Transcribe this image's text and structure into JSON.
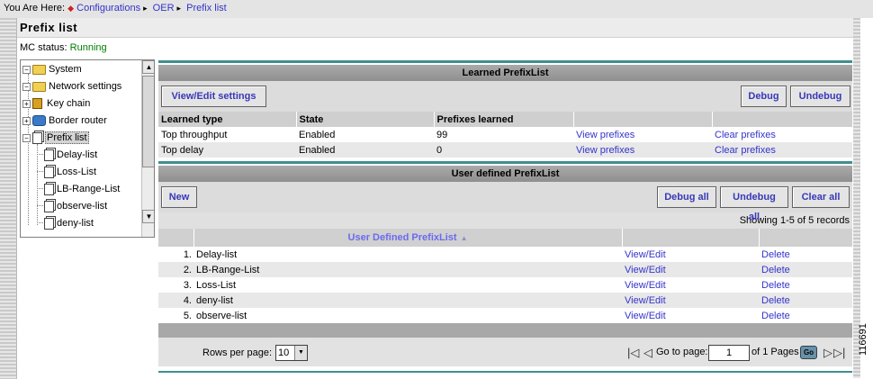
{
  "breadcrumb": {
    "prefix": "You Are Here:",
    "items": [
      "Configurations",
      "OER",
      "Prefix list"
    ]
  },
  "page_title": "Prefix list",
  "mc_status": {
    "label": "MC status:",
    "value": "Running"
  },
  "tree": {
    "items": [
      {
        "label": "System",
        "icon": "folder-icon",
        "expander": "minus"
      },
      {
        "label": "Network settings",
        "icon": "folder-icon",
        "expander": "minus"
      },
      {
        "label": "Key chain",
        "icon": "lock-icon",
        "expander": "plus"
      },
      {
        "label": "Border router",
        "icon": "router-icon",
        "expander": "plus"
      },
      {
        "label": "Prefix list",
        "icon": "document-icon",
        "expander": "minus",
        "selected": true
      },
      {
        "label": "Delay-list",
        "icon": "document-icon"
      },
      {
        "label": "Loss-List",
        "icon": "document-icon"
      },
      {
        "label": "LB-Range-List",
        "icon": "document-icon"
      },
      {
        "label": "observe-list",
        "icon": "document-icon"
      },
      {
        "label": "deny-list",
        "icon": "document-icon"
      }
    ]
  },
  "learned": {
    "title": "Learned PrefixList",
    "buttons": {
      "view_edit": "View/Edit settings",
      "debug": "Debug",
      "undebug": "Undebug"
    },
    "columns": [
      "Learned type",
      "State",
      "Prefixes learned",
      "",
      ""
    ],
    "rows": [
      {
        "type": "Top throughput",
        "state": "Enabled",
        "prefixes": "99",
        "view": "View prefixes",
        "clear": "Clear prefixes"
      },
      {
        "type": "Top delay",
        "state": "Enabled",
        "prefixes": "0",
        "view": "View prefixes",
        "clear": "Clear prefixes"
      }
    ]
  },
  "user_defined": {
    "title": "User defined PrefixList",
    "buttons": {
      "new": "New",
      "debug_all": "Debug all",
      "undebug_all": "Undebug all",
      "clear_all": "Clear all"
    },
    "showing": "Showing 1-5 of 5 records",
    "column": "User Defined PrefixList",
    "rows": [
      {
        "num": "1.",
        "name": "Delay-list",
        "edit": "View/Edit",
        "delete": "Delete"
      },
      {
        "num": "2.",
        "name": "LB-Range-List",
        "edit": "View/Edit",
        "delete": "Delete"
      },
      {
        "num": "3.",
        "name": "Loss-List",
        "edit": "View/Edit",
        "delete": "Delete"
      },
      {
        "num": "4.",
        "name": "deny-list",
        "edit": "View/Edit",
        "delete": "Delete"
      },
      {
        "num": "5.",
        "name": "observe-list",
        "edit": "View/Edit",
        "delete": "Delete"
      }
    ]
  },
  "pagination": {
    "rows_per_page_label": "Rows per page:",
    "rows_per_page": "10",
    "go_to_label": "Go to page:",
    "page": "1",
    "of_pages": "of 1 Pages",
    "go": "Go"
  },
  "watermark": "116691",
  "colors": {
    "link": "#3333cc",
    "status_ok": "#008000",
    "teal_rule": "#3f8f8f",
    "header_gray": "#999999"
  }
}
